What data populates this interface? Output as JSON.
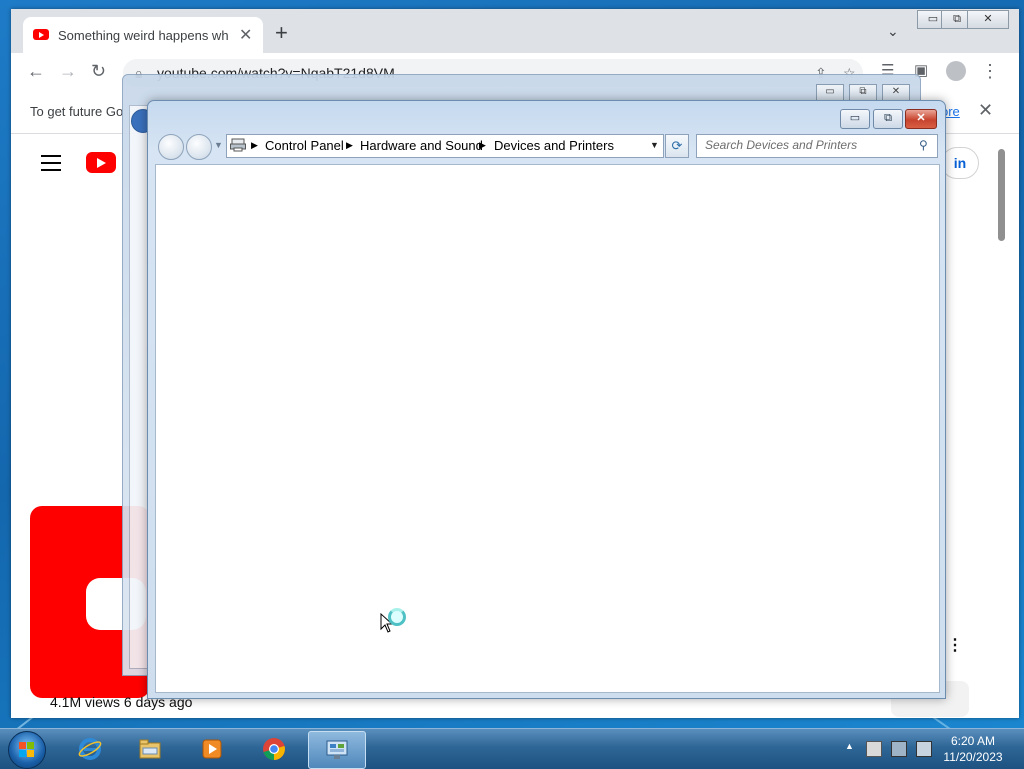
{
  "browser": {
    "tab_title": "Something weird happens when",
    "tab_close": "✕",
    "new_tab": "+",
    "tab_search": "⌄",
    "controls": {
      "minimize": "▭",
      "restore": "⧉",
      "close": "✕"
    },
    "url": "youtube.com/watch?v=NqabT21d8VM",
    "infobar_text": "To get future Go",
    "infobar_link": "ore",
    "infobar_close": "✕",
    "signin_label": "in",
    "views_text": "4.1M views  6 days ago",
    "more_dots": "⋮"
  },
  "explorer_bg": {
    "controls": {
      "minimize": "▭",
      "restore": "⧉",
      "close": "✕"
    }
  },
  "devices_window": {
    "breadcrumbs": [
      "Control Panel",
      "Hardware and Sound",
      "Devices and Printers"
    ],
    "search_placeholder": "Search Devices and Printers",
    "controls": {
      "minimize": "▭",
      "restore": "⧉",
      "close": "✕"
    },
    "refresh_icon": "⟳",
    "dropdown": "▼",
    "sep": "▶"
  },
  "taskbar": {
    "pinned": [
      "internet-explorer",
      "windows-explorer",
      "media-player",
      "google-chrome",
      "control-panel"
    ],
    "active": "control-panel",
    "clock_time": "6:20 AM",
    "clock_date": "11/20/2023",
    "tray_up": "▲"
  },
  "colors": {
    "youtube_red": "#ff0000",
    "link_blue": "#1a73e8",
    "taskbar": "#2e6697"
  }
}
